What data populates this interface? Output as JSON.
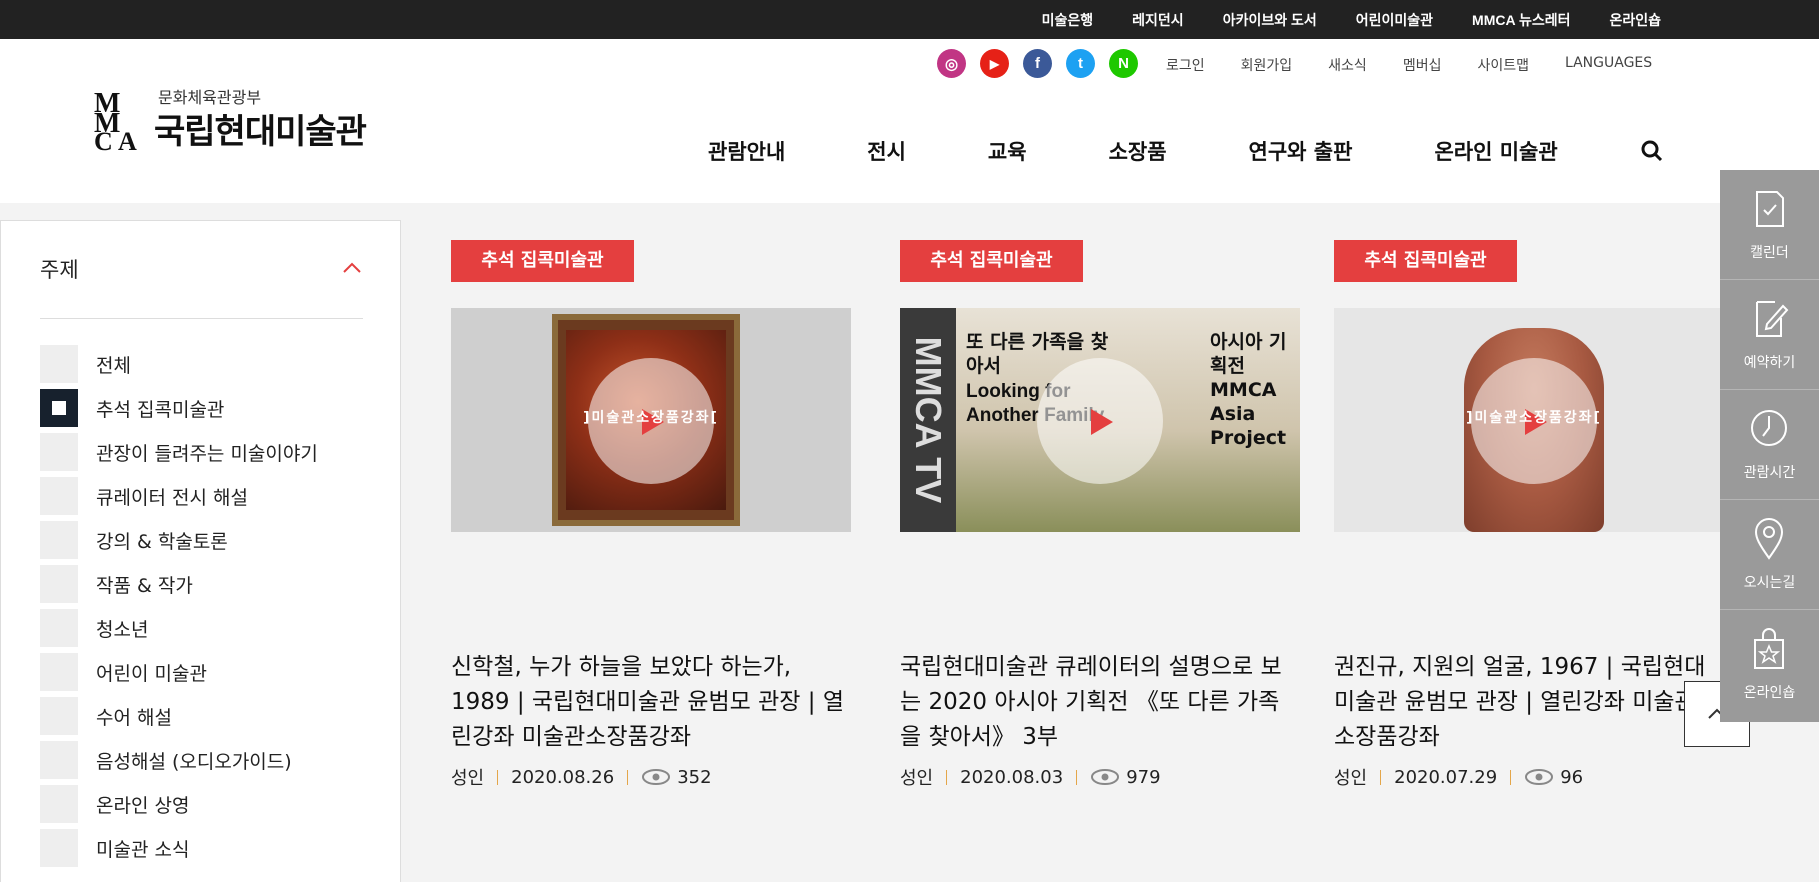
{
  "topbar": {
    "items": [
      "미술은행",
      "레지던시",
      "아카이브와 도서",
      "어린이미술관",
      "MMCA 뉴스레터",
      "온라인숍"
    ]
  },
  "header": {
    "logo": {
      "mark": "MMCA",
      "ministry": "문화체육관광부",
      "name": "국립현대미술관"
    },
    "social": [
      {
        "name": "instagram-icon",
        "glyph": "◎",
        "color": "#c13584"
      },
      {
        "name": "youtube-icon",
        "glyph": "▶",
        "color": "#e62117"
      },
      {
        "name": "facebook-icon",
        "glyph": "f",
        "color": "#3b5998"
      },
      {
        "name": "twitter-icon",
        "glyph": "t",
        "color": "#1da1f2"
      },
      {
        "name": "naver-icon",
        "glyph": "N",
        "color": "#1ec800"
      }
    ],
    "util": [
      "로그인",
      "회원가입",
      "새소식",
      "멤버십",
      "사이트맵",
      "LANGUAGES"
    ],
    "gnb": [
      "관람안내",
      "전시",
      "교육",
      "소장품",
      "연구와 출판",
      "온라인 미술관"
    ]
  },
  "sidebar": {
    "heading": "주제",
    "filters": [
      {
        "label": "전체",
        "checked": false
      },
      {
        "label": "추석 집콕미술관",
        "checked": true
      },
      {
        "label": "관장이 들려주는 미술이야기",
        "checked": false
      },
      {
        "label": "큐레이터 전시 해설",
        "checked": false
      },
      {
        "label": "강의 & 학술토론",
        "checked": false
      },
      {
        "label": "작품 & 작가",
        "checked": false
      },
      {
        "label": "청소년",
        "checked": false
      },
      {
        "label": "어린이 미술관",
        "checked": false
      },
      {
        "label": "수어 해설",
        "checked": false
      },
      {
        "label": "음성해설 (오디오가이드)",
        "checked": false
      },
      {
        "label": "온라인 상영",
        "checked": false
      },
      {
        "label": "미술관 소식",
        "checked": false
      }
    ]
  },
  "cards": [
    {
      "tag": "추석 집콕미술관",
      "overlay": "]미술관소장품강좌[",
      "title": "신학철, 누가 하늘을 보았다 하는가, 1989 | 국립현대미술관 윤범모 관장 | 열린강좌 미술관소장품강좌",
      "audience": "성인",
      "date": "2020.08.26",
      "views": "352"
    },
    {
      "tag": "추석 집콕미술관",
      "overlay": "",
      "thumb_text": [
        "MMCA TV",
        "또 다른 가족을 찾아서",
        "Looking for Another Family",
        "아시아 기획전 MMCA Asia Project"
      ],
      "title": "국립현대미술관 큐레이터의 설명으로 보는 2020 아시아 기획전 《또 다른 가족을 찾아서》 3부",
      "audience": "성인",
      "date": "2020.08.03",
      "views": "979"
    },
    {
      "tag": "추석 집콕미술관",
      "overlay": "]미술관소장품강좌[",
      "title": "권진규, 지원의 얼굴, 1967 | 국립현대미술관 윤범모 관장 | 열린강좌 미술관소장품강좌",
      "audience": "성인",
      "date": "2020.07.29",
      "views": "96"
    }
  ],
  "quick_menu": [
    {
      "label": "캘린더",
      "icon": "calendar-icon"
    },
    {
      "label": "예약하기",
      "icon": "reservation-icon"
    },
    {
      "label": "관람시간",
      "icon": "clock-icon"
    },
    {
      "label": "오시는길",
      "icon": "location-icon"
    },
    {
      "label": "온라인숍",
      "icon": "shop-icon"
    }
  ],
  "colors": {
    "accent": "#e43f3f",
    "topbar": "#222222",
    "quick_menu": "#9a9a9a",
    "checked_box": "#17212d"
  }
}
